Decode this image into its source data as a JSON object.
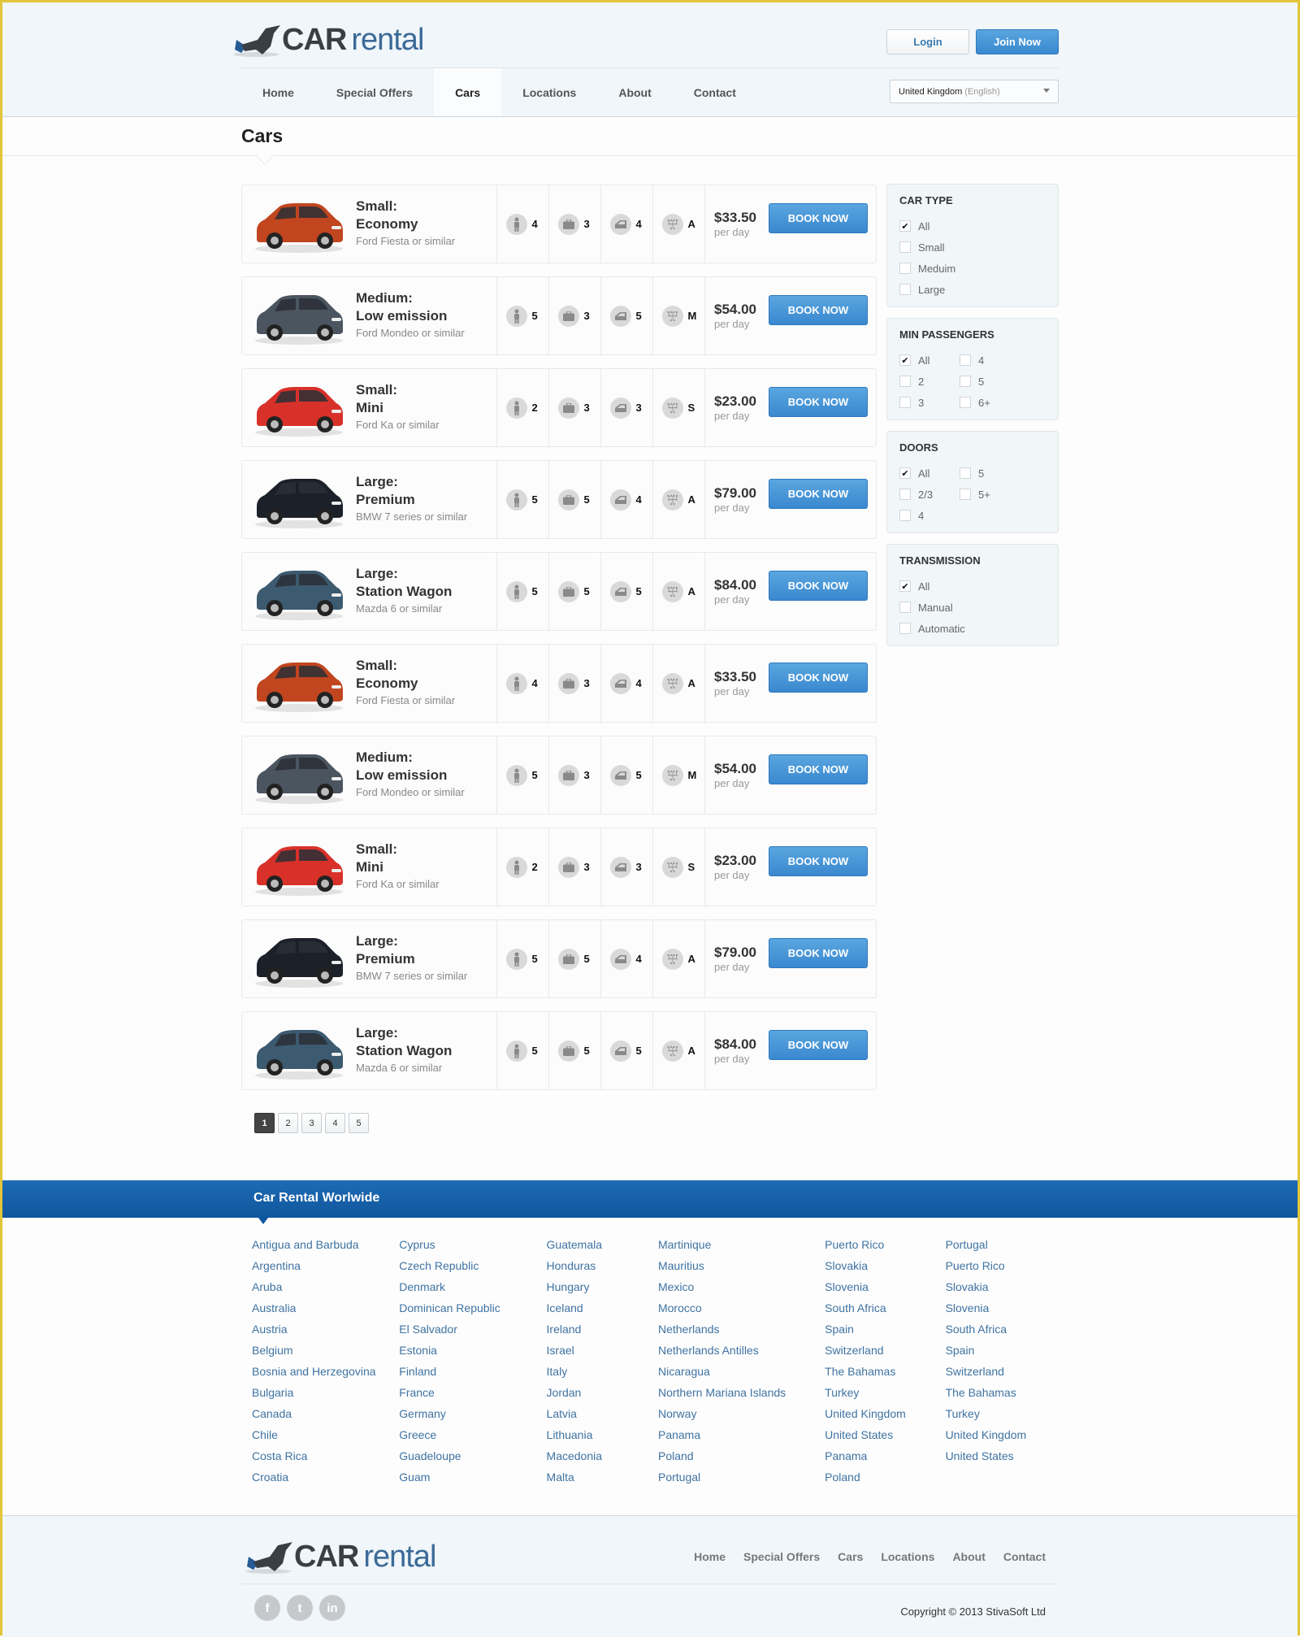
{
  "brand": {
    "car": "CAR",
    "rental": "rental"
  },
  "auth": {
    "login": "Login",
    "join": "Join Now"
  },
  "nav": [
    {
      "label": "Home",
      "active": false
    },
    {
      "label": "Special Offers",
      "active": false
    },
    {
      "label": "Cars",
      "active": true
    },
    {
      "label": "Locations",
      "active": false
    },
    {
      "label": "About",
      "active": false
    },
    {
      "label": "Contact",
      "active": false
    }
  ],
  "language": {
    "country": "United Kingdom",
    "lang": "(English)"
  },
  "page_title": "Cars",
  "cars": [
    {
      "class": "Small:",
      "type": "Economy",
      "model": "Ford Fiesta or similar",
      "passengers": "4",
      "bags": "3",
      "doors": "4",
      "transmission": "A",
      "price": "$33.50",
      "unit": "per day",
      "color": "#c1451f",
      "book": "BOOK NOW"
    },
    {
      "class": "Medium:",
      "type": "Low emission",
      "model": "Ford Mondeo or similar",
      "passengers": "5",
      "bags": "3",
      "doors": "5",
      "transmission": "M",
      "price": "$54.00",
      "unit": "per day",
      "color": "#4b5560",
      "book": "BOOK NOW"
    },
    {
      "class": "Small:",
      "type": "Mini",
      "model": "Ford Ka or similar",
      "passengers": "2",
      "bags": "3",
      "doors": "3",
      "transmission": "S",
      "price": "$23.00",
      "unit": "per day",
      "color": "#d8312a",
      "book": "BOOK NOW"
    },
    {
      "class": "Large:",
      "type": "Premium",
      "model": "BMW 7 series or similar",
      "passengers": "5",
      "bags": "5",
      "doors": "4",
      "transmission": "A",
      "price": "$79.00",
      "unit": "per day",
      "color": "#1b2029",
      "book": "BOOK NOW"
    },
    {
      "class": "Large:",
      "type": "Station Wagon",
      "model": "Mazda 6 or similar",
      "passengers": "5",
      "bags": "5",
      "doors": "5",
      "transmission": "A",
      "price": "$84.00",
      "unit": "per day",
      "color": "#3c5a70",
      "book": "BOOK NOW"
    },
    {
      "class": "Small:",
      "type": "Economy",
      "model": "Ford Fiesta or similar",
      "passengers": "4",
      "bags": "3",
      "doors": "4",
      "transmission": "A",
      "price": "$33.50",
      "unit": "per day",
      "color": "#c1451f",
      "book": "BOOK NOW"
    },
    {
      "class": "Medium:",
      "type": "Low emission",
      "model": "Ford Mondeo or similar",
      "passengers": "5",
      "bags": "3",
      "doors": "5",
      "transmission": "M",
      "price": "$54.00",
      "unit": "per day",
      "color": "#4b5560",
      "book": "BOOK NOW"
    },
    {
      "class": "Small:",
      "type": "Mini",
      "model": "Ford Ka or similar",
      "passengers": "2",
      "bags": "3",
      "doors": "3",
      "transmission": "S",
      "price": "$23.00",
      "unit": "per day",
      "color": "#d8312a",
      "book": "BOOK NOW"
    },
    {
      "class": "Large:",
      "type": "Premium",
      "model": "BMW 7 series or similar",
      "passengers": "5",
      "bags": "5",
      "doors": "4",
      "transmission": "A",
      "price": "$79.00",
      "unit": "per day",
      "color": "#1b2029",
      "book": "BOOK NOW"
    },
    {
      "class": "Large:",
      "type": "Station Wagon",
      "model": "Mazda 6 or similar",
      "passengers": "5",
      "bags": "5",
      "doors": "5",
      "transmission": "A",
      "price": "$84.00",
      "unit": "per day",
      "color": "#3c5a70",
      "book": "BOOK NOW"
    }
  ],
  "pagination": {
    "pages": [
      "1",
      "2",
      "3",
      "4",
      "5"
    ],
    "current": "1"
  },
  "filters": [
    {
      "title": "CAR TYPE",
      "columns": 1,
      "options": [
        {
          "label": "All",
          "checked": true
        },
        {
          "label": "Small",
          "checked": false
        },
        {
          "label": "Meduim",
          "checked": false
        },
        {
          "label": "Large",
          "checked": false
        }
      ]
    },
    {
      "title": "MIN PASSENGERS",
      "columns": 2,
      "options": [
        {
          "label": "All",
          "checked": true
        },
        {
          "label": "2",
          "checked": false
        },
        {
          "label": "3",
          "checked": false
        },
        {
          "label": "4",
          "checked": false
        },
        {
          "label": "5",
          "checked": false
        },
        {
          "label": "6+",
          "checked": false
        }
      ]
    },
    {
      "title": "DOORS",
      "columns": 2,
      "options": [
        {
          "label": "All",
          "checked": true
        },
        {
          "label": "2/3",
          "checked": false
        },
        {
          "label": "4",
          "checked": false
        },
        {
          "label": "5",
          "checked": false
        },
        {
          "label": "5+",
          "checked": false
        }
      ]
    },
    {
      "title": "TRANSMISSION",
      "columns": 1,
      "options": [
        {
          "label": "All",
          "checked": true
        },
        {
          "label": "Manual",
          "checked": false
        },
        {
          "label": "Automatic",
          "checked": false
        }
      ]
    }
  ],
  "worldwide": {
    "title": "Car Rental Worlwide",
    "columns": [
      [
        "Antigua and Barbuda",
        "Argentina",
        "Aruba",
        "Australia",
        "Austria",
        "Belgium",
        "Bosnia and Herzegovina",
        "Bulgaria",
        "Canada",
        "Chile",
        "Costa Rica",
        "Croatia"
      ],
      [
        "Cyprus",
        "Czech Republic",
        "Denmark",
        "Dominican Republic",
        "El Salvador",
        "Estonia",
        "Finland",
        "France",
        "Germany",
        "Greece",
        "Guadeloupe",
        "Guam"
      ],
      [
        "Guatemala",
        "Honduras",
        "Hungary",
        "Iceland",
        "Ireland",
        "Israel",
        "Italy",
        "Jordan",
        "Latvia",
        "Lithuania",
        "Macedonia",
        "Malta"
      ],
      [
        "Martinique",
        "Mauritius",
        "Mexico",
        "Morocco",
        "Netherlands",
        "Netherlands Antilles",
        "Nicaragua",
        "Northern Mariana Islands",
        "Norway",
        "Panama",
        "Poland",
        "Portugal"
      ],
      [
        "Puerto Rico",
        "Slovakia",
        "Slovenia",
        "South Africa",
        "Spain",
        "Switzerland",
        "The Bahamas",
        "Turkey",
        "United Kingdom",
        "United States",
        "Panama",
        "Poland"
      ],
      [
        "Portugal",
        "Puerto Rico",
        "Slovakia",
        "Slovenia",
        "South Africa",
        "Spain",
        "Switzerland",
        "The Bahamas",
        "Turkey",
        "United Kingdom",
        "United States"
      ]
    ]
  },
  "footer": {
    "nav": [
      "Home",
      "Special Offers",
      "Cars",
      "Locations",
      "About",
      "Contact"
    ],
    "social": [
      {
        "name": "facebook",
        "glyph": "f"
      },
      {
        "name": "twitter",
        "glyph": "t"
      },
      {
        "name": "linkedin",
        "glyph": "in"
      }
    ],
    "copyright": "Copyright © 2013 StivaSoft Ltd"
  }
}
